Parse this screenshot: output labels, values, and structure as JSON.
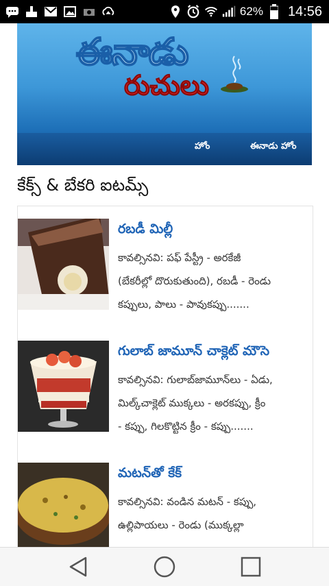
{
  "status_bar": {
    "battery_percent": "62%",
    "time": "14:56",
    "icons": [
      "chat-icon",
      "download-icon",
      "gmail-icon",
      "image-icon",
      "camera-icon",
      "cloud-sync-icon",
      "location-icon",
      "alarm-icon",
      "wifi-icon",
      "signal-icon",
      "battery-icon"
    ]
  },
  "header": {
    "logo_line1": "ఈనాడు",
    "logo_line2": "రుచులు",
    "nav": {
      "home": "హోం",
      "eenadu_home": "ఈనాడు హోం"
    }
  },
  "section": {
    "title": "కేక్స్ & బేకరి ఐటమ్స్"
  },
  "items": [
    {
      "title": "రబడీ మిల్లీ",
      "desc_lines": [
        "కావల్సినవి: పఫ్ పేస్ట్రీ - అరకేజీ",
        "(బేకరీల్లో దొరుకుతుంది), రబడీ - రెండు",
        "కప్పులు, పాలు - పావుకప్పు......."
      ]
    },
    {
      "title": "గులాబ్ జామూన్ చాక్లెట్ మౌసె",
      "desc_lines": [
        "కావల్సినవి: గులాబ్‌జామూన్‌లు - ఏడు,",
        "మిల్క్‌చాక్లెట్ ముక్కలు - అరకప్పు, క్రీం",
        "- కప్పు, గిలకొట్టిన క్రీం - కప్పు......."
      ]
    },
    {
      "title": "మటన్‌తో కేక్",
      "desc_lines": [
        "కావల్సినవి: వండిన మటన్ - కప్పు,",
        "ఉల్లిపాయలు - రెండు (ముక్కల్లా"
      ]
    }
  ],
  "colors": {
    "link_blue": "#1f64b6",
    "banner_blue": "#3d97d8",
    "logo_red": "#e02323"
  }
}
